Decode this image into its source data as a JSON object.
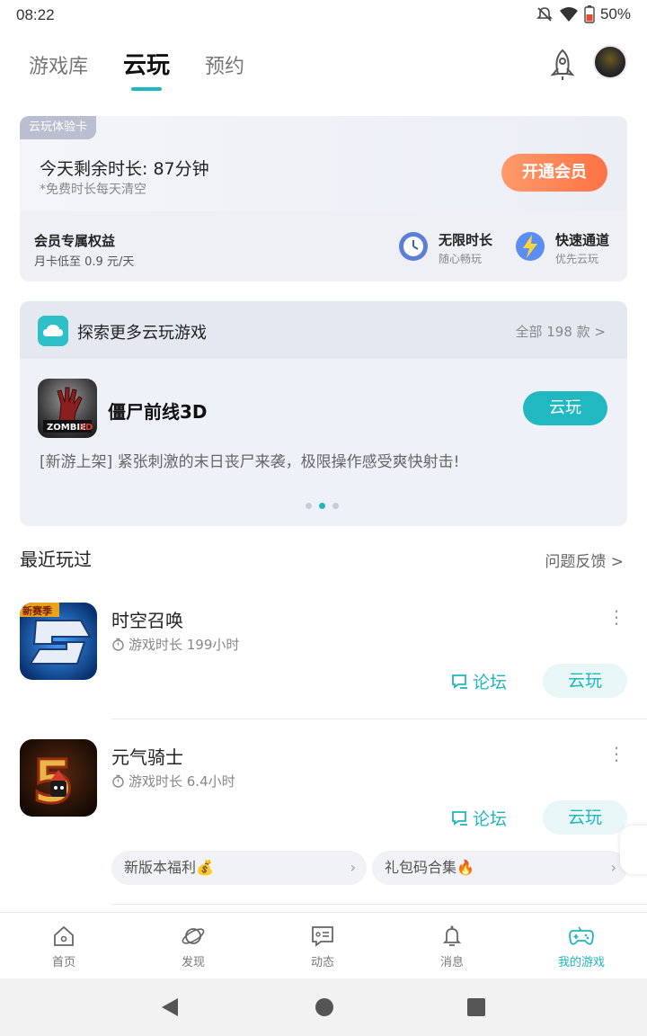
{
  "status_bar": {
    "time": "08:22",
    "battery": "50%"
  },
  "top_tabs": [
    {
      "label": "游戏库"
    },
    {
      "label": "云玩"
    },
    {
      "label": "预约"
    }
  ],
  "member_card": {
    "badge": "云玩体验卡",
    "remaining_time": "今天剩余时长: 87分钟",
    "note": "*免费时长每天清空",
    "button": "开通会员",
    "benefit_title": "会员专属权益",
    "benefit_price": "月卡低至 0.9 元/天",
    "perks": [
      {
        "title": "无限时长",
        "subtitle": "随心畅玩",
        "icon": "clock-icon"
      },
      {
        "title": "快速通道",
        "subtitle": "优先云玩",
        "icon": "lightning-icon"
      }
    ]
  },
  "explore": {
    "title": "探索更多云玩游戏",
    "all_link": "全部 198 款 >",
    "featured_game": {
      "name": "僵尸前线3D",
      "button": "云玩",
      "description": "[新游上架] 紧张刺激的末日丧尸来袭，极限操作感受爽快射击!"
    },
    "carousel": {
      "pages": 3,
      "active": 2
    }
  },
  "recent": {
    "title": "最近玩过",
    "feedback": "问题反馈 >",
    "games": [
      {
        "name": "时空召唤",
        "playtime": "游戏时长 199小时",
        "forum": "论坛",
        "play": "云玩"
      },
      {
        "name": "元气骑士",
        "playtime": "游戏时长 6.4小时",
        "forum": "论坛",
        "play": "云玩"
      }
    ],
    "chips": [
      {
        "label": "新版本福利💰"
      },
      {
        "label": "礼包码合集🔥"
      }
    ]
  },
  "bottom_nav": [
    {
      "label": "首页",
      "icon": "home-icon"
    },
    {
      "label": "发现",
      "icon": "planet-icon"
    },
    {
      "label": "动态",
      "icon": "chat-card-icon"
    },
    {
      "label": "消息",
      "icon": "bell-icon"
    },
    {
      "label": "我的游戏",
      "icon": "gamepad-icon",
      "active": true
    }
  ],
  "colors": {
    "accent": "#1fb6bf",
    "vip_orange": "#ff7f4f"
  }
}
